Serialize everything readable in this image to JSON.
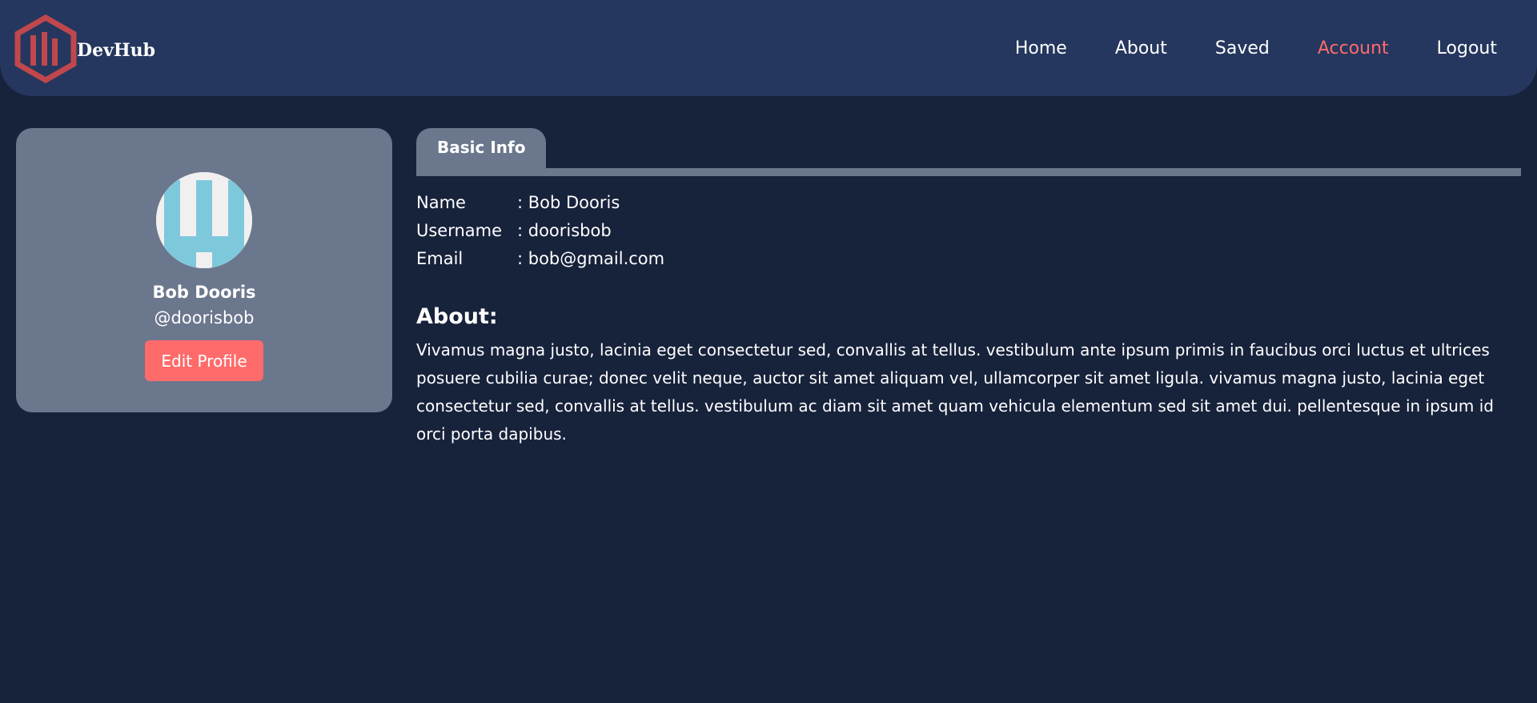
{
  "brand": {
    "name": "DevHub",
    "logo_color": "#c0474d"
  },
  "nav": {
    "items": [
      {
        "label": "Home",
        "active": false
      },
      {
        "label": "About",
        "active": false
      },
      {
        "label": "Saved",
        "active": false
      },
      {
        "label": "Account",
        "active": true
      },
      {
        "label": "Logout",
        "active": false
      }
    ]
  },
  "profile": {
    "name": "Bob Dooris",
    "handle": "@doorisbob",
    "edit_button": "Edit Profile"
  },
  "tabs": [
    {
      "label": "Basic Info",
      "active": true
    }
  ],
  "basic_info": [
    {
      "label": "Name",
      "value": ": Bob Dooris"
    },
    {
      "label": "Username",
      "value": ": doorisbob"
    },
    {
      "label": "Email",
      "value": ": bob@gmail.com"
    }
  ],
  "about": {
    "title": "About:",
    "text": "Vivamus magna justo, lacinia eget consectetur sed, convallis at tellus. vestibulum ante ipsum primis in faucibus orci luctus et ultrices posuere cubilia curae; donec velit neque, auctor sit amet aliquam vel, ullamcorper sit amet ligula. vivamus magna justo, lacinia eget consectetur sed, convallis at tellus. vestibulum ac diam sit amet quam vehicula elementum sed sit amet dui. pellentesque in ipsum id orci porta dapibus."
  },
  "colors": {
    "background": "#17223b",
    "navbar": "#25375e",
    "card": "#6b778d",
    "accent": "#ff6b6b",
    "avatar_pattern": "#7ec8dc"
  }
}
